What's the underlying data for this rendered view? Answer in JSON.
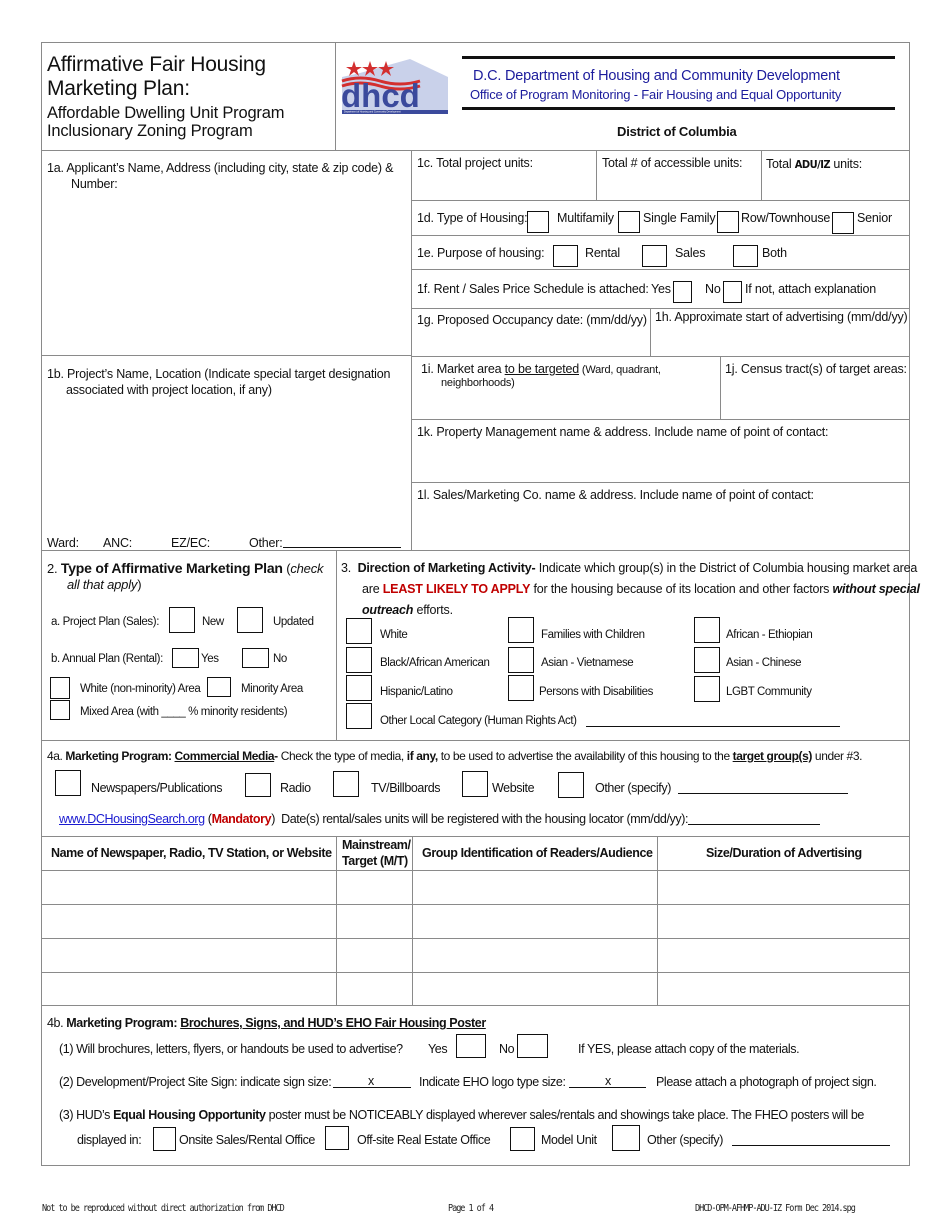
{
  "header": {
    "title_line1": "Affirmative Fair Housing",
    "title_line2": "Marketing Plan:",
    "subtitle_line1": "Affordable Dwelling Unit Program",
    "subtitle_line2": "Inclusionary Zoning Program",
    "logo_text": "dhcd",
    "logo_caption": "Department of Housing and Community Development",
    "agency_line1": "D.C. Department of Housing and  Community Development",
    "agency_line2": "Office of Program Monitoring - Fair Housing and Equal Opportunity",
    "jurisdiction": "District of Columbia"
  },
  "section1": {
    "q1a_line1": "1a.  Applicant’s Name, Address  (including city, state & zip code) &",
    "q1a_line2": "Number:",
    "q1b_line1": "1b. Project’s Name, Location (Indicate special target designation",
    "q1b_line2": "associated with project location, if any)",
    "ward_label": "Ward:",
    "anc_label": "ANC:",
    "ezec_label": "EZ/EC:",
    "other_label": "Other:",
    "q1c": "1c. Total project units:",
    "accessible_units": "Total # of accessible units:",
    "adu_prefix": "Total ",
    "adu_bold": "ADU/IZ",
    "adu_suffix": " units:",
    "q1d_label": "1d. Type of Housing:",
    "q1d_options": [
      "Multifamily",
      "Single Family",
      "Row/Townhouse",
      "Senior"
    ],
    "q1e_label": "1e. Purpose of housing:",
    "q1e_options": [
      "Rental",
      "Sales",
      "Both"
    ],
    "q1f_label": "1f.  Rent / Sales Price Schedule is attached:",
    "q1f_yes": "Yes",
    "q1f_no": "No",
    "q1f_note": "If not, attach  explanation",
    "q1g": "1g. Proposed Occupancy date: (mm/dd/yy)",
    "q1h": "1h. Approximate start of advertising (mm/dd/yy)",
    "q1i_prefix": "1i. Market area ",
    "q1i_underlined": "to be targeted",
    "q1i_small": " (Ward, quadrant,",
    "q1i_line2": "neighborhoods)",
    "q1j": "1j. Census tract(s) of target areas:",
    "q1k": "1k. Property Management name & address. Include name of point of contact:",
    "q1l": "1l. Sales/Marketing Co. name & address. Include name of point of contact:"
  },
  "section2": {
    "number": "2.",
    "title": "Type of Affirmative Marketing Plan",
    "note_open": " (",
    "note_italic1": "check",
    "note_italic2": "all that apply",
    "note_close": ")",
    "a_label": "a.  Project Plan (Sales):",
    "a_opt1": "New",
    "a_opt2": "Updated",
    "b_label": "b.  Annual Plan (Rental):",
    "b_opt1": "Yes",
    "b_opt2": "No",
    "area_white": "White (non-minority) Area",
    "area_minority": "Minority Area",
    "area_mixed": "Mixed Area (with  ____ % minority residents)"
  },
  "section3": {
    "number": "3.",
    "title": "Direction of Marketing Activity-",
    "intro": " Indicate which group(s) in the District of Columbia housing market area",
    "line2_pre": "are ",
    "line2_red": "LEAST LIKELY TO APPLY",
    "line2_mid": " for the housing because of its location and other factors ",
    "line2_bi": "without special",
    "line3_bi": "outreach",
    "line3_rest": " efforts.",
    "groups": [
      "White",
      "Families with Children",
      "African - Ethiopian",
      "Black/African American",
      "Asian - Vietnamese",
      "Asian - Chinese",
      "Hispanic/Latino",
      "Persons with Disabilities",
      "LGBT Community"
    ],
    "other_category": "Other  Local  Category (Human Rights Act)"
  },
  "section4a": {
    "prefix": "4a. ",
    "bold1": "Marketing Program: ",
    "bold_u": "Commercial Media",
    "bold2": "-",
    "text1": " Check the type of media, ",
    "bold3": "if any,",
    "text2": " to be used to advertise the availability of this housing to the ",
    "bold_u2": "target group(s)",
    "text3": " under #3.",
    "media": [
      "Newspapers/Publications",
      "Radio",
      "TV/Billboards",
      "Website",
      "Other (specify)"
    ],
    "link": "www.DCHousingSearch.org",
    "mandatory": "Mandatory",
    "locator_text": "Date(s) rental/sales units will be registered with the housing locator (mm/dd/yy):",
    "table_headers": [
      "Name of Newspaper, Radio, TV Station, or Website",
      "Mainstream/",
      "Target (M/T)",
      "Group Identification of Readers/Audience",
      "Size/Duration of Advertising"
    ],
    "table_rows": [
      [
        "",
        "",
        "",
        ""
      ],
      [
        "",
        "",
        "",
        ""
      ],
      [
        "",
        "",
        "",
        ""
      ],
      [
        "",
        "",
        "",
        ""
      ]
    ]
  },
  "section4b": {
    "prefix": "4b. ",
    "bold": "Marketing Program: ",
    "bold_u": "Brochures, Signs, and HUD’s EHO Fair Housing Poster",
    "q1": "(1) Will brochures, letters, flyers, or handouts be used to advertise?",
    "q1_yes": "Yes",
    "q1_no": "No",
    "q1_note": "If YES, please attach copy of the materials.",
    "q2_text": "(2) Development/Project Site Sign: indicate sign size:",
    "q2_x": "x",
    "q2_logo": "Indicate EHO logo type size:",
    "q2_note": "Please attach a photograph of project sign.",
    "q3_pre": "(3) HUD’s ",
    "q3_bold": "Equal Housing Opportunity",
    "q3_rest": " poster must be NOTICEABLY displayed wherever sales/rentals and showings take place.  The FHEO posters will be",
    "q3_line2": "displayed in:",
    "q3_options": [
      "Onsite Sales/Rental Office",
      "Off-site Real Estate Office",
      "Model Unit",
      "Other (specify)"
    ]
  },
  "footer": {
    "left": "Not to be reproduced without direct authorization from DHCD",
    "center": "Page 1 of 4",
    "right": "DHCD-OPM-AFHMP-ADU-IZ Form Dec 2014.spg"
  },
  "colors": {
    "agency_blue": "#1c1c9c",
    "emphasis_red": "#c00000",
    "link_blue": "#1a1ad0"
  }
}
